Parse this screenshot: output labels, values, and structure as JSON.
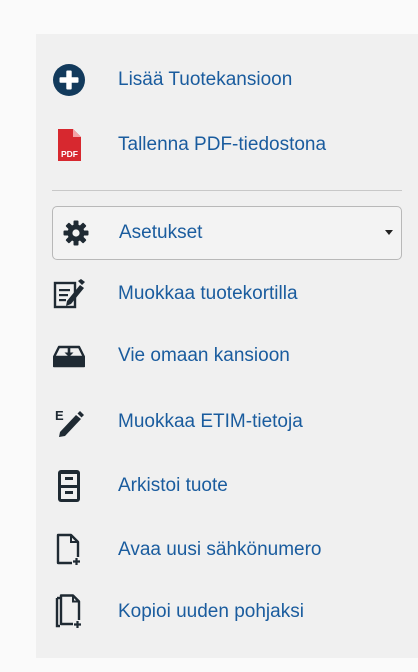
{
  "actions": {
    "add_to_folder": {
      "label": "Lisää Tuotekansioon",
      "icon": "plus-circle-icon"
    },
    "save_pdf": {
      "label": "Tallenna PDF-tiedostona",
      "icon": "pdf-file-icon",
      "badge": "PDF"
    }
  },
  "settings": {
    "label": "Asetukset",
    "icon": "gear-icon",
    "items": [
      {
        "label": "Muokkaa tuotekortilla",
        "icon": "edit-card-icon"
      },
      {
        "label": "Vie omaan kansioon",
        "icon": "download-tray-icon"
      },
      {
        "label": "Muokkaa ETIM-tietoja",
        "icon": "etim-edit-icon",
        "glyph": "E"
      },
      {
        "label": "Arkistoi tuote",
        "icon": "archive-cabinet-icon"
      },
      {
        "label": "Avaa uusi sähkönumero",
        "icon": "new-document-icon"
      },
      {
        "label": "Kopioi uuden pohjaksi",
        "icon": "copy-document-icon"
      }
    ]
  },
  "colors": {
    "link": "#1a5c9e",
    "icon_dark": "#1f2a33",
    "add_icon": "#123a5c",
    "pdf_red": "#d7282f"
  }
}
